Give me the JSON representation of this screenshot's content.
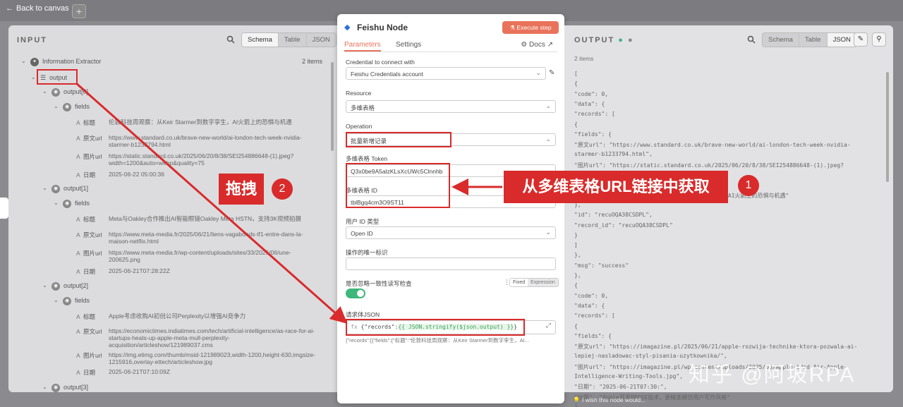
{
  "topbar": {
    "back_label": "Back to canvas",
    "plus_label": "+"
  },
  "input": {
    "title": "INPUT",
    "tabs": [
      "Schema",
      "Table",
      "JSON"
    ],
    "root": "Information Extractor",
    "root_count": "2 items",
    "output_label": "output",
    "fields_label": "fields",
    "items": [
      {
        "label": "output[0]",
        "title_k": "标题",
        "title_v": "伦敦科技周观察：从Keir Starmer到数字孪生，AI火箭上的恐惧与机遇",
        "url_k": "原文url",
        "url_v": "https://www.standard.co.uk/brave-new-world/ai-london-tech-week-nvidia-starmer-b1233794.html",
        "img_k": "图片url",
        "img_v": "https://static.standard.co.uk/2025/06/20/8/38/SEI254886648-(1).jpeg?width=1200&auto=webp&quality=75",
        "date_k": "日期",
        "date_v": "2025-06-22 05:00:36"
      },
      {
        "label": "output[1]",
        "title_k": "标题",
        "title_v": "Meta与Oakley合作推出AI智能眼镜Oakley Meta HSTN，支持3K视频拍摄",
        "url_k": "原文url",
        "url_v": "https://www.meta-media.fr/2025/06/21/liens-vagabonds-tf1-entre-dans-la-maison-netflix.html",
        "img_k": "图片url",
        "img_v": "https://www.meta-media.fr/wp-content/uploads/sites/33/2025/06/une-200625.png",
        "date_k": "日期",
        "date_v": "2025-06-21T07:28:22Z"
      },
      {
        "label": "output[2]",
        "title_k": "标题",
        "title_v": "Apple考虑收购AI初创公司Perplexity以增强AI竞争力",
        "url_k": "原文url",
        "url_v": "https://economictimes.indiatimes.com/tech/artificial-intelligence/as-race-for-ai-startups-heats-up-apple-meta-mull-perplexity-acquisition/articleshow/121989037.cms",
        "img_k": "图片url",
        "img_v": "https://img.etimg.com/thumb/msid-121989023,width-1200,height-630,imgsize-1215916,overlay-ettech/articleshow.jpg",
        "date_k": "日期",
        "date_v": "2025-06-21T07:10:09Z"
      },
      {
        "label": "output[3]"
      }
    ]
  },
  "node": {
    "title": "Feishu Node",
    "execute_label": "Execute step",
    "tabs": [
      "Parameters",
      "Settings"
    ],
    "docs_label": "Docs",
    "credential_label": "Credential to connect with",
    "credential_value": "Feishu Credentials account",
    "resource_label": "Resource",
    "resource_value": "多维表格",
    "operation_label": "Operation",
    "operation_value": "批量新增记录",
    "token_label": "多维表格 Token",
    "token_value": "Q3x0be9A5alzKLsXcUWc5Clnnhb",
    "table_id_label": "多维表格 ID",
    "table_id_value": "tblBgq4cm3O9ST11",
    "user_id_label": "用户 ID 类型",
    "user_id_value": "Open ID",
    "unique_label": "操作的唯一标识",
    "unique_value": "",
    "consistency_label": "是否忽略一致性读写检查",
    "fixed_label": "Fixed",
    "expression_label": "Expression",
    "body_label": "请求体JSON",
    "body_prefix": "{\"records\":",
    "body_expr": "{{ JSON.stringify($json.output) }}",
    "body_suffix": "}",
    "body_preview": "{\"records\":[{\"fields\":{\"标题\":\"伦敦科技周观察：从Keir Starmer到数字孪生，AI..."
  },
  "output": {
    "title": "OUTPUT",
    "count": "2 items",
    "tabs": [
      "Schema",
      "Table",
      "JSON"
    ],
    "json_lines": [
      "[",
      "  {",
      "    \"code\": 0,",
      "    \"data\": {",
      "      \"records\": [",
      "        {",
      "          \"fields\": {",
      "            \"原文url\": \"https://www.standard.co.uk/brave-new-world/ai-london-tech-week-nvidia-",
      "                      starmer-b1233794.html\",",
      "            \"图片url\": \"https://static.standard.co.uk/2025/06/20/8/38/SEI254886648-(1).jpeg?",
      "                      width=1200&auto=webp&quality=75\",",
      "            \"日期\": \"2025-06-22 05:00:36\",",
      "            \"标题\": \"伦敦科技周观察：从Keir Starmer到数字孪生，AI火箭上的恐惧与机遇\"",
      "          },",
      "          \"id\": \"recuOQA38CSDPL\",",
      "          \"record_id\": \"recuOQA38CSDPL\"",
      "        }",
      "      ]",
      "    },",
      "    \"msg\": \"success\"",
      "  },",
      "  {",
      "    \"code\": 0,",
      "    \"data\": {",
      "      \"records\": [",
      "        {",
      "          \"fields\": {",
      "            \"原文url\": \"https://imagazine.pl/2025/06/21/apple-rozwija-technike-ktora-pozwala-ai-",
      "                      lepiej-nasladowac-styl-pisania-uzytkownika/\",",
      "            \"图片url\": \"https://imagazine.pl/wp-content/uploads/2025/03/Apple-iPad-Air-Apple-",
      "                      Intelligence-Writing-Tools.jpg\",",
      "            \"日期\": \"2025-06-21T07:30:\",",
      "            \"标题\": \"Apple开发PROSE技术，更精准模仿用户写作风格\"",
      "          },"
    ],
    "tip": "I wish this node would..."
  },
  "annotations": {
    "drag_label": "拖拽",
    "drag_num": "2",
    "source_label": "从多维表格URL链接中获取",
    "source_num": "1"
  },
  "watermark": "知乎 @阿坡RPA",
  "colors": {
    "accent": "#e8735a",
    "annotation": "#d92b2b",
    "toggle": "#3db77b"
  }
}
